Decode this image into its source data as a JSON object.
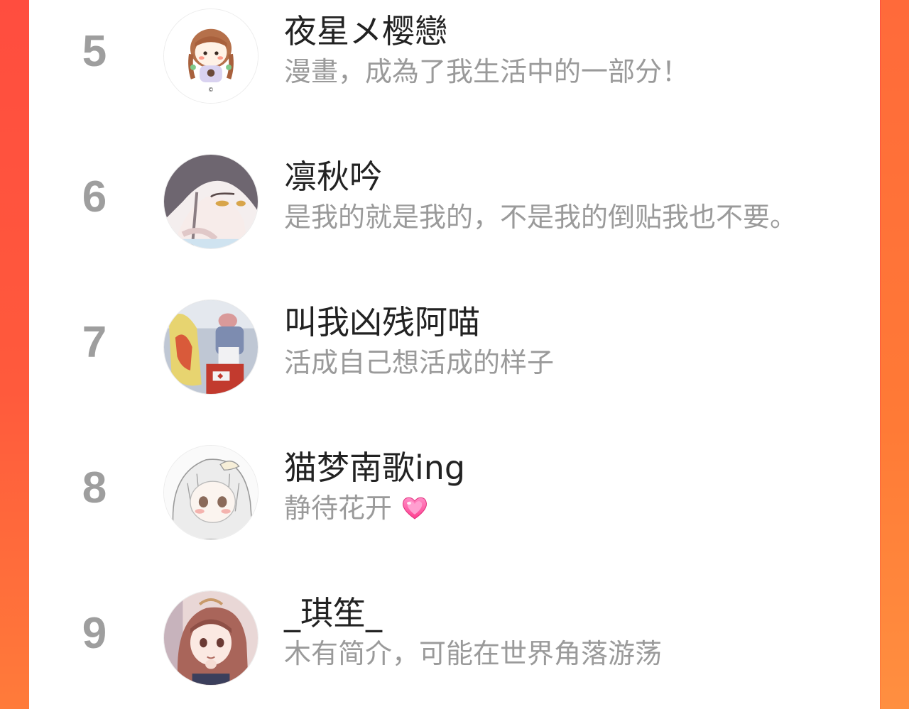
{
  "colors": {
    "background_left": "#ff4d3f",
    "background_right": "#ff7b3a",
    "panel": "#ffffff",
    "rank": "#9e9e9e",
    "name": "#222222",
    "bio": "#9a9a9a",
    "heart": "#ff4fa3"
  },
  "users": [
    {
      "rank": "5",
      "name": "夜星メ樱戀",
      "bio": "漫畫，成為了我生活中的一部分！",
      "avatar": "chibi-girl-avatar"
    },
    {
      "rank": "6",
      "name": "凛秋吟",
      "bio": "是我的就是我的，不是我的倒贴我也不要。",
      "avatar": "anime-girl-sketch-avatar"
    },
    {
      "rank": "7",
      "name": "叫我凶残阿喵",
      "bio": "活成自己想活成的样子",
      "avatar": "cosplay-photo-avatar"
    },
    {
      "rank": "8",
      "name": "猫梦南歌ing",
      "bio": "静待花开",
      "bio_emoji": "sparkling-heart-icon",
      "avatar": "white-hair-anime-avatar"
    },
    {
      "rank": "9",
      "name": "_琪笙_",
      "bio": "木有简介，可能在世界角落游荡",
      "avatar": "brown-hair-anime-avatar"
    }
  ]
}
